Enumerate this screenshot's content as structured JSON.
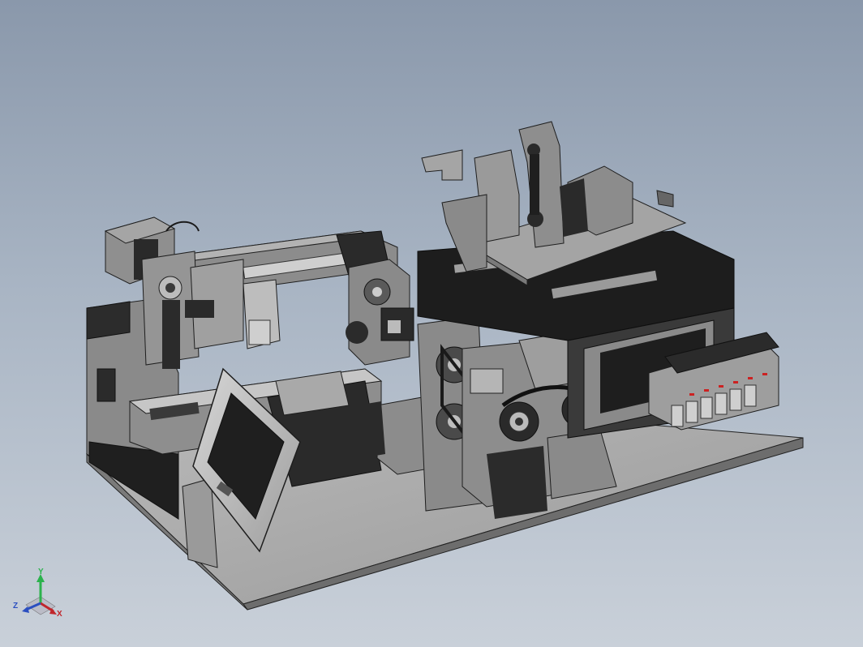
{
  "viewport": {
    "background_top": "#8a98ab",
    "background_bottom": "#c9d0d9"
  },
  "model": {
    "body_color": "#8e8e8e",
    "dark_color": "#2a2a2a",
    "plate_color": "#a9a9a9",
    "accent_color": "#d0d0d0"
  },
  "triad": {
    "x_label": "X",
    "y_label": "Y",
    "z_label": "Z",
    "x_color": "#c0262b",
    "y_color": "#2bb24c",
    "z_color": "#2b4fc0"
  }
}
